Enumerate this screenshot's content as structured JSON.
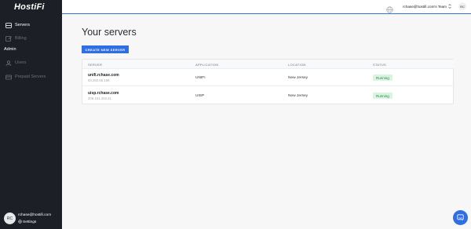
{
  "sidebar": {
    "logo": "HostiFi",
    "items": [
      {
        "label": "Servers",
        "icon": "server-icon",
        "active": true
      },
      {
        "label": "Billing",
        "icon": "billing-icon",
        "active": false
      }
    ],
    "admin_section": "Admin",
    "admin_items": [
      {
        "label": "Users",
        "icon": "users-icon"
      },
      {
        "label": "Prepaid Servers",
        "icon": "prepaid-icon"
      }
    ],
    "footer": {
      "avatar_initials": "RC",
      "email": "rchase@hostifi.com",
      "settings_label": "Settings"
    }
  },
  "topbar": {
    "team_label": "rchase@hostifi.com's Team",
    "avatar_initials": "RC"
  },
  "main": {
    "title": "Your servers",
    "create_button": "CREATE NEW SERVER",
    "table": {
      "headers": [
        "SERVER",
        "APPLICATION",
        "LOCATION",
        "STATUS"
      ],
      "rows": [
        {
          "server": "unifi.rchase.com",
          "ip": "63.250.55.158",
          "application": "UNIFI",
          "location": "New Jersey",
          "status": "Running"
        },
        {
          "server": "uisp.rchase.com",
          "ip": "209.161.203.41",
          "application": "UISP",
          "location": "New Jersey",
          "status": "Running"
        }
      ]
    }
  },
  "colors": {
    "accent": "#2f6fe6",
    "sidebar_bg": "#1c2026",
    "status_running_bg": "#d9f4e1",
    "status_running_text": "#1f8a47"
  }
}
